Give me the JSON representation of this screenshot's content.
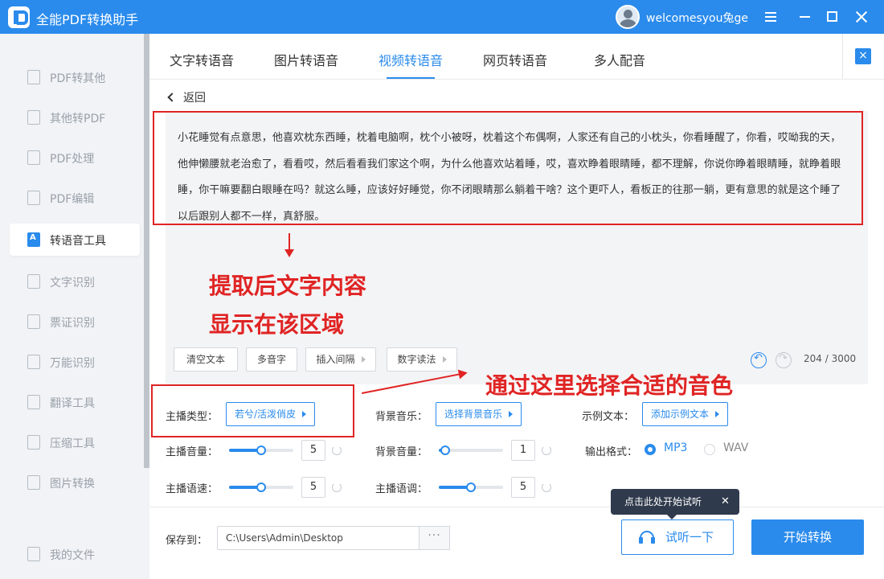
{
  "app": {
    "title": "全能PDF转换助手",
    "username": "welcomesyou兔ge",
    "brand_color": "#2a8bec"
  },
  "sidebar": {
    "items": [
      {
        "label": "PDF转其他",
        "icon": "pdf-file-icon"
      },
      {
        "label": "其他转PDF",
        "icon": "pdf-file-icon"
      },
      {
        "label": "PDF处理",
        "icon": "pdf-process-icon"
      },
      {
        "label": "PDF编辑",
        "icon": "pdf-edit-icon"
      },
      {
        "label": "转语音工具",
        "icon": "text-to-speech-icon",
        "active": true
      },
      {
        "label": "文字识别",
        "icon": "text-ocr-icon"
      },
      {
        "label": "票证识别",
        "icon": "ticket-ocr-icon"
      },
      {
        "label": "万能识别",
        "icon": "universal-ocr-icon"
      },
      {
        "label": "翻译工具",
        "icon": "translate-icon"
      },
      {
        "label": "压缩工具",
        "icon": "compress-icon"
      },
      {
        "label": "图片转换",
        "icon": "image-convert-icon"
      },
      {
        "label": "我的文件",
        "icon": "my-files-icon"
      }
    ]
  },
  "tabs": [
    {
      "label": "文字转语音"
    },
    {
      "label": "图片转语音"
    },
    {
      "label": "视频转语音",
      "active": true
    },
    {
      "label": "网页转语音"
    },
    {
      "label": "多人配音"
    }
  ],
  "back_label": "返回",
  "extracted_text": "小花睡觉有点意思，他喜欢枕东西睡，枕着电脑啊，枕个小被呀，枕着这个布偶啊，人家还有自己的小枕头，你看睡醒了，你看，哎呦我的天，他伸懒腰就老治愈了，看看哎，然后看看我们家这个啊，为什么他喜欢站着睡，哎，喜欢睁着眼睛睡，都不理解，你说你睁着眼睛睡，就睁着眼睡，你干嘛要翻白眼睡在吗？就这么睡，应该好好睡觉，你不闭眼睛那么躺着干啥？这个更吓人，看板正的往那一躺，更有意思的就是这个睡了以后跟别人都不一样，真舒服。",
  "annotations": {
    "text_area_line1": "提取后文字内容",
    "text_area_line2": "显示在该区域",
    "voice_tip": "通过这里选择合适的音色",
    "color": "#e02424"
  },
  "toolbar": {
    "clear_text": "清空文本",
    "polyphone": "多音字",
    "insert_pause": "插入间隔",
    "number_reading": "数字读法",
    "char_count": "204 / 3000"
  },
  "settings": {
    "anchor_type_label": "主播类型：",
    "anchor_type_value": "若兮/活泼俏皮",
    "bg_music_label": "背景音乐：",
    "bg_music_value": "选择背景音乐",
    "sample_text_label": "示例文本：",
    "sample_text_value": "添加示例文本",
    "anchor_volume_label": "主播音量：",
    "anchor_volume_value": "5",
    "anchor_volume_level": 0.5,
    "bg_volume_label": "背景音量：",
    "bg_volume_value": "1",
    "bg_volume_level": 0.1,
    "output_format_label": "输出格式：",
    "format_mp3": "MP3",
    "format_wav": "WAV",
    "anchor_speed_label": "主播语速：",
    "anchor_speed_value": "5",
    "anchor_speed_level": 0.5,
    "anchor_tone_label": "主播语调：",
    "anchor_tone_value": "5",
    "anchor_tone_level": 0.5
  },
  "bottom": {
    "save_to_label": "保存到：",
    "save_path": "C:\\Users\\Admin\\Desktop",
    "browse_label": "···",
    "tooltip": "点击此处开始试听",
    "listen_label": "试听一下",
    "start_label": "开始转换"
  }
}
